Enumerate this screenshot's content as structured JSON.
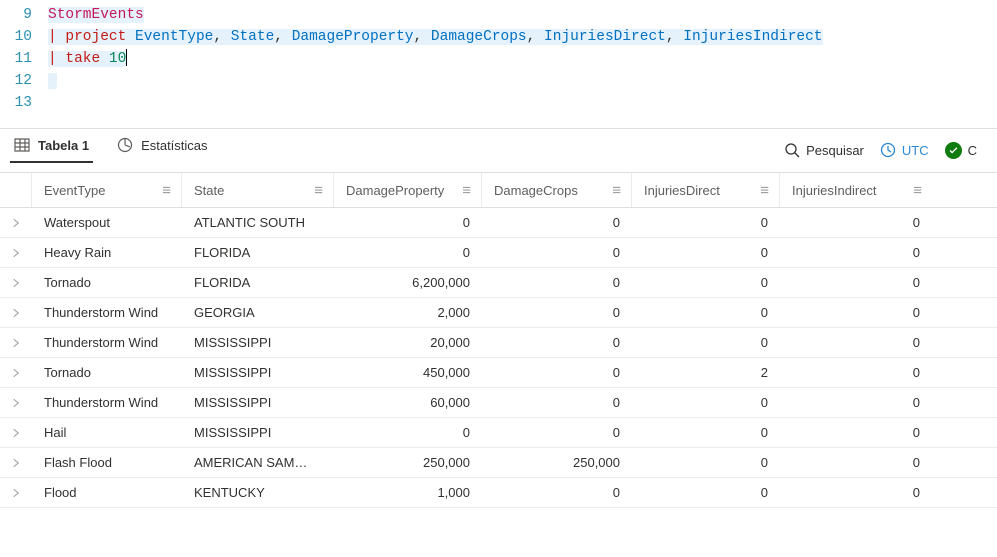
{
  "editor": {
    "lines": [
      {
        "num": 9
      },
      {
        "num": 10
      },
      {
        "num": 11
      },
      {
        "num": 12
      },
      {
        "num": 13
      }
    ],
    "table_name": "StormEvents",
    "op_project": "project",
    "op_take": "take",
    "take_value": "10",
    "cols": {
      "c0": "EventType",
      "c1": "State",
      "c2": "DamageProperty",
      "c3": "DamageCrops",
      "c4": "InjuriesDirect",
      "c5": "InjuriesIndirect"
    }
  },
  "tabs": {
    "tab_table": "Tabela 1",
    "tab_stats": "Estatísticas"
  },
  "toolbar": {
    "search_label": "Pesquisar",
    "utc_label": "UTC",
    "status_label": "C"
  },
  "columns": {
    "c0": "EventType",
    "c1": "State",
    "c2": "DamageProperty",
    "c3": "DamageCrops",
    "c4": "InjuriesDirect",
    "c5": "InjuriesIndirect"
  },
  "rows": [
    {
      "c0": "Waterspout",
      "c1": "ATLANTIC SOUTH",
      "c2": "0",
      "c3": "0",
      "c4": "0",
      "c5": "0"
    },
    {
      "c0": "Heavy Rain",
      "c1": "FLORIDA",
      "c2": "0",
      "c3": "0",
      "c4": "0",
      "c5": "0"
    },
    {
      "c0": "Tornado",
      "c1": "FLORIDA",
      "c2": "6,200,000",
      "c3": "0",
      "c4": "0",
      "c5": "0"
    },
    {
      "c0": "Thunderstorm Wind",
      "c1": "GEORGIA",
      "c2": "2,000",
      "c3": "0",
      "c4": "0",
      "c5": "0"
    },
    {
      "c0": "Thunderstorm Wind",
      "c1": "MISSISSIPPI",
      "c2": "20,000",
      "c3": "0",
      "c4": "0",
      "c5": "0"
    },
    {
      "c0": "Tornado",
      "c1": "MISSISSIPPI",
      "c2": "450,000",
      "c3": "0",
      "c4": "2",
      "c5": "0"
    },
    {
      "c0": "Thunderstorm Wind",
      "c1": "MISSISSIPPI",
      "c2": "60,000",
      "c3": "0",
      "c4": "0",
      "c5": "0"
    },
    {
      "c0": "Hail",
      "c1": "MISSISSIPPI",
      "c2": "0",
      "c3": "0",
      "c4": "0",
      "c5": "0"
    },
    {
      "c0": "Flash Flood",
      "c1": "AMERICAN SAM…",
      "c2": "250,000",
      "c3": "250,000",
      "c4": "0",
      "c5": "0"
    },
    {
      "c0": "Flood",
      "c1": "KENTUCKY",
      "c2": "1,000",
      "c3": "0",
      "c4": "0",
      "c5": "0"
    }
  ]
}
